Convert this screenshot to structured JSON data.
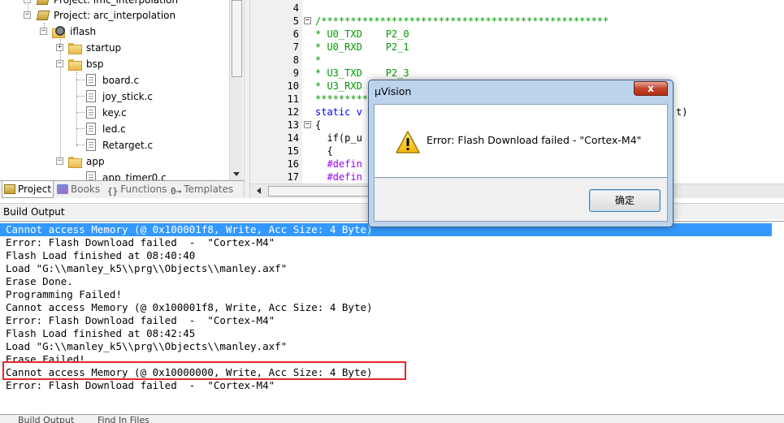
{
  "project_tree": {
    "items": [
      {
        "label": "Project: lmc_interpolation"
      },
      {
        "label": "Project: arc_interpolation"
      },
      {
        "label": "iflash"
      },
      {
        "label": "startup"
      },
      {
        "label": "bsp"
      },
      {
        "label": "board.c"
      },
      {
        "label": "joy_stick.c"
      },
      {
        "label": "key.c"
      },
      {
        "label": "led.c"
      },
      {
        "label": "Retarget.c"
      },
      {
        "label": "app"
      },
      {
        "label": "app_timer0.c"
      }
    ],
    "expanders": {
      "collapsed": "+",
      "expanded": "−"
    }
  },
  "panel_tabs": [
    {
      "label": "Project",
      "active": true
    },
    {
      "label": "Books",
      "active": false
    },
    {
      "label": "Functions",
      "active": false,
      "glyph": "{}"
    },
    {
      "label": "Templates",
      "active": false,
      "glyph": "0→"
    }
  ],
  "editor": {
    "lines": [
      {
        "num": "4",
        "text": "",
        "cls": "c-norm",
        "fold": ""
      },
      {
        "num": "5",
        "text": "/*************************************************",
        "cls": "c-comment",
        "fold": "−"
      },
      {
        "num": "6",
        "text": "* U0_TXD    P2_0",
        "cls": "c-comment",
        "fold": ""
      },
      {
        "num": "7",
        "text": "* U0_RXD    P2_1",
        "cls": "c-comment",
        "fold": ""
      },
      {
        "num": "8",
        "text": "*",
        "cls": "c-comment",
        "fold": ""
      },
      {
        "num": "9",
        "text": "* U3_TXD    P2_3",
        "cls": "c-comment",
        "fold": ""
      },
      {
        "num": "10",
        "text": "* U3_RXD",
        "cls": "c-comment",
        "fold": ""
      },
      {
        "num": "11",
        "text": "*********",
        "cls": "c-comment",
        "fold": ""
      },
      {
        "num": "12",
        "text": "static v",
        "cls": "c-kw",
        "fold": ""
      },
      {
        "num": "13",
        "text": "{",
        "cls": "c-norm",
        "fold": "−"
      },
      {
        "num": "14",
        "text": "  if(p_u",
        "cls": "c-norm",
        "fold": ""
      },
      {
        "num": "15",
        "text": "  {",
        "cls": "c-norm",
        "fold": ""
      },
      {
        "num": "16",
        "text": "  #defin",
        "cls": "c-pp",
        "fold": ""
      },
      {
        "num": "17",
        "text": "  #defin",
        "cls": "c-pp",
        "fold": ""
      }
    ],
    "line12_tail": "t)"
  },
  "build_output": {
    "title": "Build Output",
    "lines": [
      {
        "text": "Cannot access Memory (@ 0x100001f8, Write, Acc Size: 4 Byte)",
        "selected": true
      },
      {
        "text": "Error: Flash Download failed  -  \"Cortex-M4\"",
        "selected": false
      },
      {
        "text": "Flash Load finished at 08:40:40",
        "selected": false
      },
      {
        "text": "Load \"G:\\\\manley_k5\\\\prg\\\\Objects\\\\manley.axf\"",
        "selected": false
      },
      {
        "text": "Erase Done.",
        "selected": false
      },
      {
        "text": "Programming Failed!",
        "selected": false
      },
      {
        "text": "Cannot access Memory (@ 0x100001f8, Write, Acc Size: 4 Byte)",
        "selected": false
      },
      {
        "text": "Error: Flash Download failed  -  \"Cortex-M4\"",
        "selected": false
      },
      {
        "text": "Flash Load finished at 08:42:45",
        "selected": false
      },
      {
        "text": "Load \"G:\\\\manley_k5\\\\prg\\\\Objects\\\\manley.axf\"",
        "selected": false
      },
      {
        "text": "Erase Failed!",
        "selected": false
      },
      {
        "text": "Cannot access Memory (@ 0x10000000, Write, Acc Size: 4 Byte)",
        "selected": false
      },
      {
        "text": "Error: Flash Download failed  -  \"Cortex-M4\"",
        "selected": false
      }
    ],
    "highlight_color": "#e8262b",
    "selection_color": "#3399ff"
  },
  "bottom_tabs": [
    {
      "label": "Build Output"
    },
    {
      "label": "Find In Files"
    }
  ],
  "dialog": {
    "title": "µVision",
    "close_glyph": "x",
    "message": "Error: Flash Download failed  -  \"Cortex-M4\"",
    "ok_label": "确定",
    "icon": "warning-icon"
  }
}
